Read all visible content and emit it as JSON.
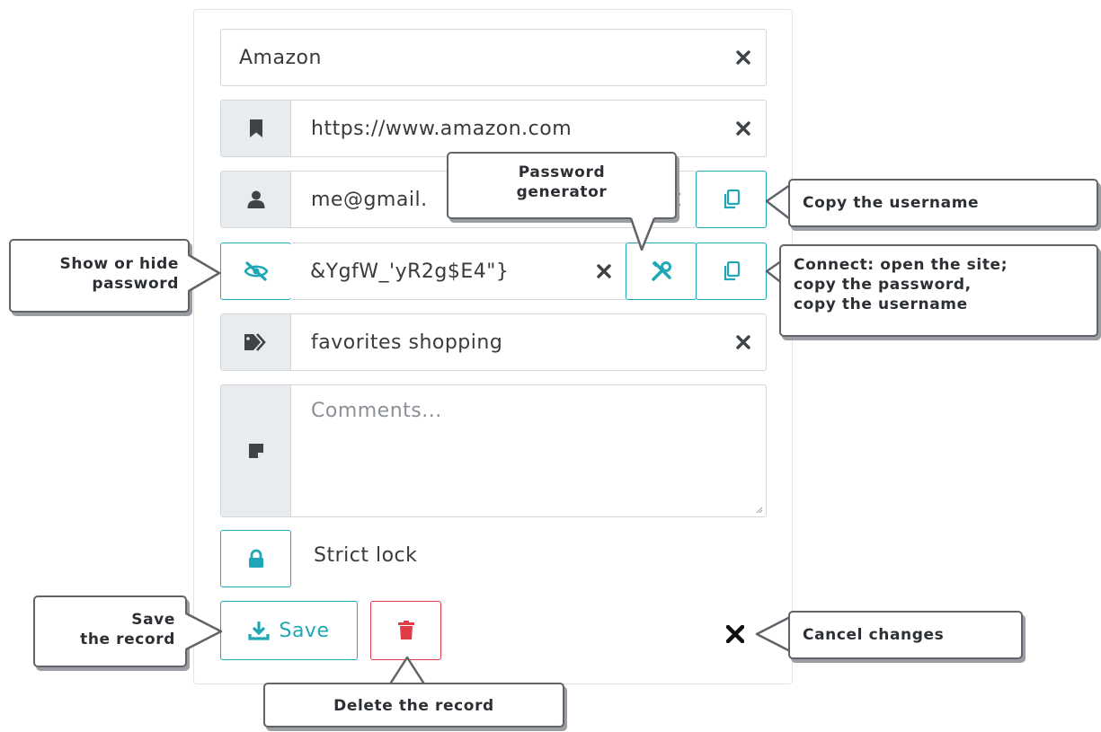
{
  "form": {
    "title_value": "Amazon",
    "url_value": "https://www.amazon.com",
    "username_value": "me@gmail.",
    "password_value": "&YgfW_'yR2g$E4\"}",
    "tags_value": "favorites shopping",
    "comments_placeholder": "Comments...",
    "strict_lock_label": "Strict lock",
    "save_label": "Save"
  },
  "callouts": {
    "password_generator": [
      "Password",
      "generator"
    ],
    "copy_username": "Copy the username",
    "show_hide_password": [
      "Show or hide",
      "password"
    ],
    "connect": [
      "Connect: open the site;",
      "copy the password,",
      "copy the username"
    ],
    "save_record": [
      "Save",
      "the record"
    ],
    "cancel_changes": "Cancel changes",
    "delete_record": "Delete the record"
  },
  "colors": {
    "accent": "#1fa7b5",
    "danger": "#e03b47",
    "addon_bg": "#e9ecef",
    "border": "#d3d6da",
    "callout_border": "#606468"
  },
  "icons": [
    "close-icon",
    "bookmark-icon",
    "user-icon",
    "eye-slash-icon",
    "tools-icon",
    "copy-icon",
    "tag-icon",
    "note-icon",
    "lock-icon",
    "download-icon",
    "trash-icon"
  ]
}
